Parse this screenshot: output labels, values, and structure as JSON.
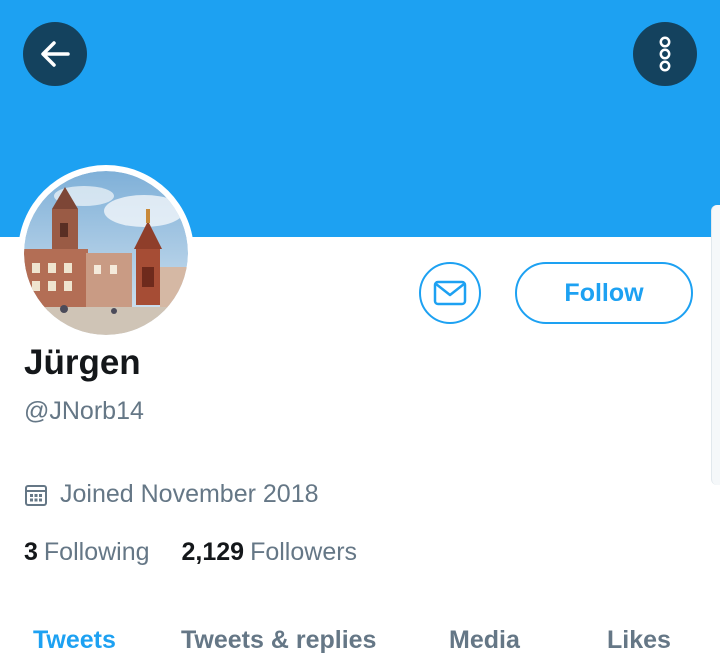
{
  "header": {
    "back_icon": "back-arrow-icon",
    "more_icon": "vertical-dots-icon",
    "banner_color": "#1da1f2"
  },
  "profile": {
    "display_name": "Jürgen",
    "handle": "@JNorb14",
    "joined": "Joined November 2018",
    "following_count": "3",
    "following_label": "Following",
    "followers_count": "2,129",
    "followers_label": "Followers"
  },
  "actions": {
    "message_icon": "envelope-icon",
    "follow_label": "Follow",
    "accent": "#1da1f2"
  },
  "tabs": [
    {
      "label": "Tweets",
      "active": true
    },
    {
      "label": "Tweets & replies",
      "active": false
    },
    {
      "label": "Media",
      "active": false
    },
    {
      "label": "Likes",
      "active": false
    }
  ]
}
